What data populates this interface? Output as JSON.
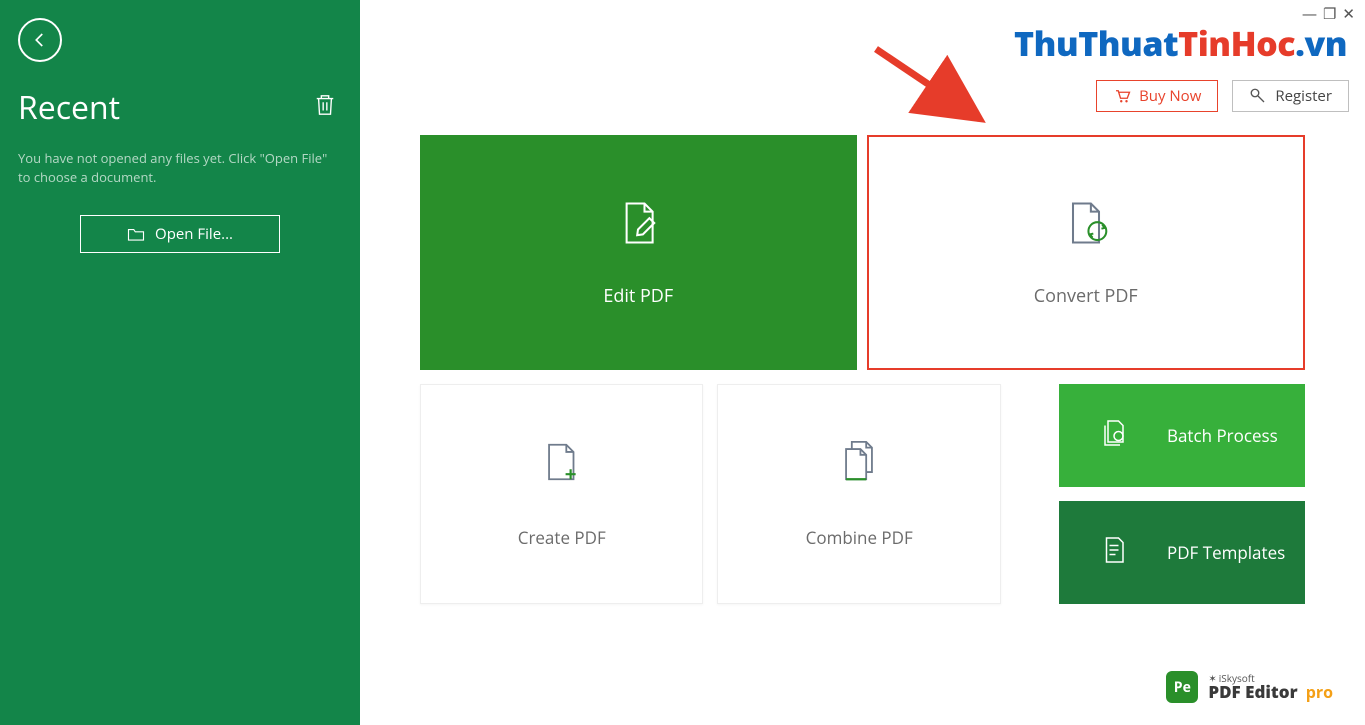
{
  "sidebar": {
    "title": "Recent",
    "description": "You have not opened any files yet. Click \"Open File\" to choose a document.",
    "open_file_label": "Open File..."
  },
  "top_buttons": {
    "buy_now": "Buy Now",
    "register": "Register"
  },
  "tiles": {
    "edit": "Edit PDF",
    "convert": "Convert PDF",
    "create": "Create PDF",
    "combine": "Combine PDF",
    "batch": "Batch Process",
    "templates": "PDF Templates"
  },
  "branding": {
    "badge": "Pe",
    "small": "iSkysoft",
    "main": "PDF Editor",
    "pro": "pro"
  },
  "watermark": {
    "a": "ThuThuat",
    "b": "TinHoc",
    "c": ".vn"
  }
}
